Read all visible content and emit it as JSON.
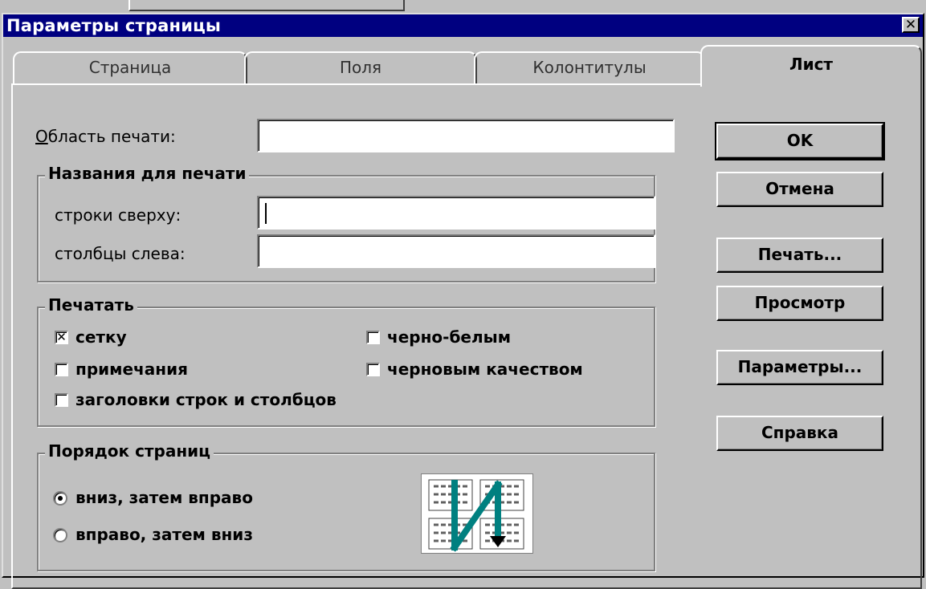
{
  "dialog": {
    "title": "Параметры страницы",
    "close_glyph": "✕"
  },
  "tabs": [
    {
      "label": "Страница",
      "active": false
    },
    {
      "label": "Поля",
      "active": false
    },
    {
      "label": "Колонтитулы",
      "active": false
    },
    {
      "label": "Лист",
      "active": true
    }
  ],
  "print_area": {
    "label": "Область печати:",
    "value": ""
  },
  "print_titles": {
    "legend": "Названия для печати",
    "rows_label": "строки сверху:",
    "rows_value": "",
    "cols_label": "столбцы слева:",
    "cols_value": ""
  },
  "print": {
    "legend": "Печатать",
    "options": [
      {
        "label": "сетку",
        "checked": true
      },
      {
        "label": "черно-белым",
        "checked": false
      },
      {
        "label": "примечания",
        "checked": false
      },
      {
        "label": "черновым качеством",
        "checked": false
      },
      {
        "label": "заголовки строк и столбцов",
        "checked": false
      }
    ]
  },
  "page_order": {
    "legend": "Порядок страниц",
    "options": [
      {
        "label": "вниз, затем вправо",
        "selected": true
      },
      {
        "label": "вправо, затем вниз",
        "selected": false
      }
    ]
  },
  "buttons": {
    "ok": "OK",
    "cancel": "Отмена",
    "print": "Печать...",
    "preview": "Просмотр",
    "options": "Параметры...",
    "help": "Справка"
  },
  "colors": {
    "titlebar": "#000080",
    "face": "#c0c0c0",
    "arrow": "#008080"
  }
}
